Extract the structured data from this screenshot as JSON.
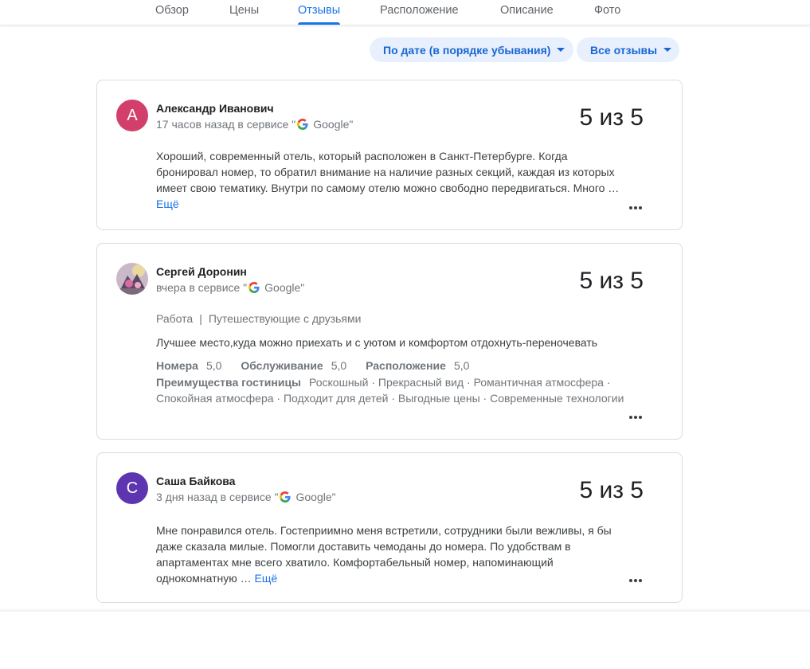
{
  "tabs": [
    {
      "label": "Обзор"
    },
    {
      "label": "Цены"
    },
    {
      "label": "Отзывы",
      "active": true
    },
    {
      "label": "Расположение"
    },
    {
      "label": "Описание"
    },
    {
      "label": "Фото"
    }
  ],
  "filters": {
    "sort_label": "По дате (в порядке убывания)",
    "type_label": "Все отзывы"
  },
  "reviews": [
    {
      "avatar_letter": "А",
      "avatar_color": "#d23f6a",
      "name": "Александр Иванович",
      "time": "17 часов назад в сервисе \"",
      "source": "Google\"",
      "rating": "5 из 5",
      "text": "Хороший, современный отель, который расположен в Санкт-Петербурге. Когда бронировал номер, то обратил внимание на наличие разных секций, каждая из которых имеет свою тематику. Внутри по самому отелю можно свободно передвигаться. Много …",
      "more_label": "Ещё"
    },
    {
      "avatar_letter": "",
      "avatar_color": "#8a7c8e",
      "name": "Сергей Доронин",
      "time": "вчера в сервисе \"",
      "source": "Google\"",
      "rating": "5 из 5",
      "tag_1": "Работа",
      "tag_sep": "|",
      "tag_2": "Путешествующие с друзьями",
      "text": "Лучшее место,куда можно приехать и с уютом и комфортом отдохнуть-переночевать",
      "scores": [
        {
          "label": "Номера",
          "value": "5,0"
        },
        {
          "label": "Обслуживание",
          "value": "5,0"
        },
        {
          "label": "Расположение",
          "value": "5,0"
        }
      ],
      "features_label": "Преимущества гостиницы",
      "features_text": "Роскошный · Прекрасный вид · Романтичная атмосфера · Спокойная атмосфера · Подходит для детей · Выгодные цены · Современные технологии"
    },
    {
      "avatar_letter": "С",
      "avatar_color": "#5e35b1",
      "name": "Саша Байкова",
      "time": "3 дня назад в сервисе \"",
      "source": "Google\"",
      "rating": "5 из 5",
      "text": "Мне понравился отель. Гостеприимно меня встретили, сотрудники были вежливы, я бы даже сказала милые. Помогли доставить чемоданы до номера. По удобствам в апартаментах мне всего хватило. Комфортабельный номер, напоминающий однокомнатную …",
      "more_label": "Ещё"
    }
  ],
  "colors": {
    "accent": "#1a73e8",
    "chip_bg": "#e8f0fe"
  },
  "icons": {
    "google": "google-g-icon",
    "more": "more-horiz-icon",
    "dropdown": "caret-down-icon"
  }
}
